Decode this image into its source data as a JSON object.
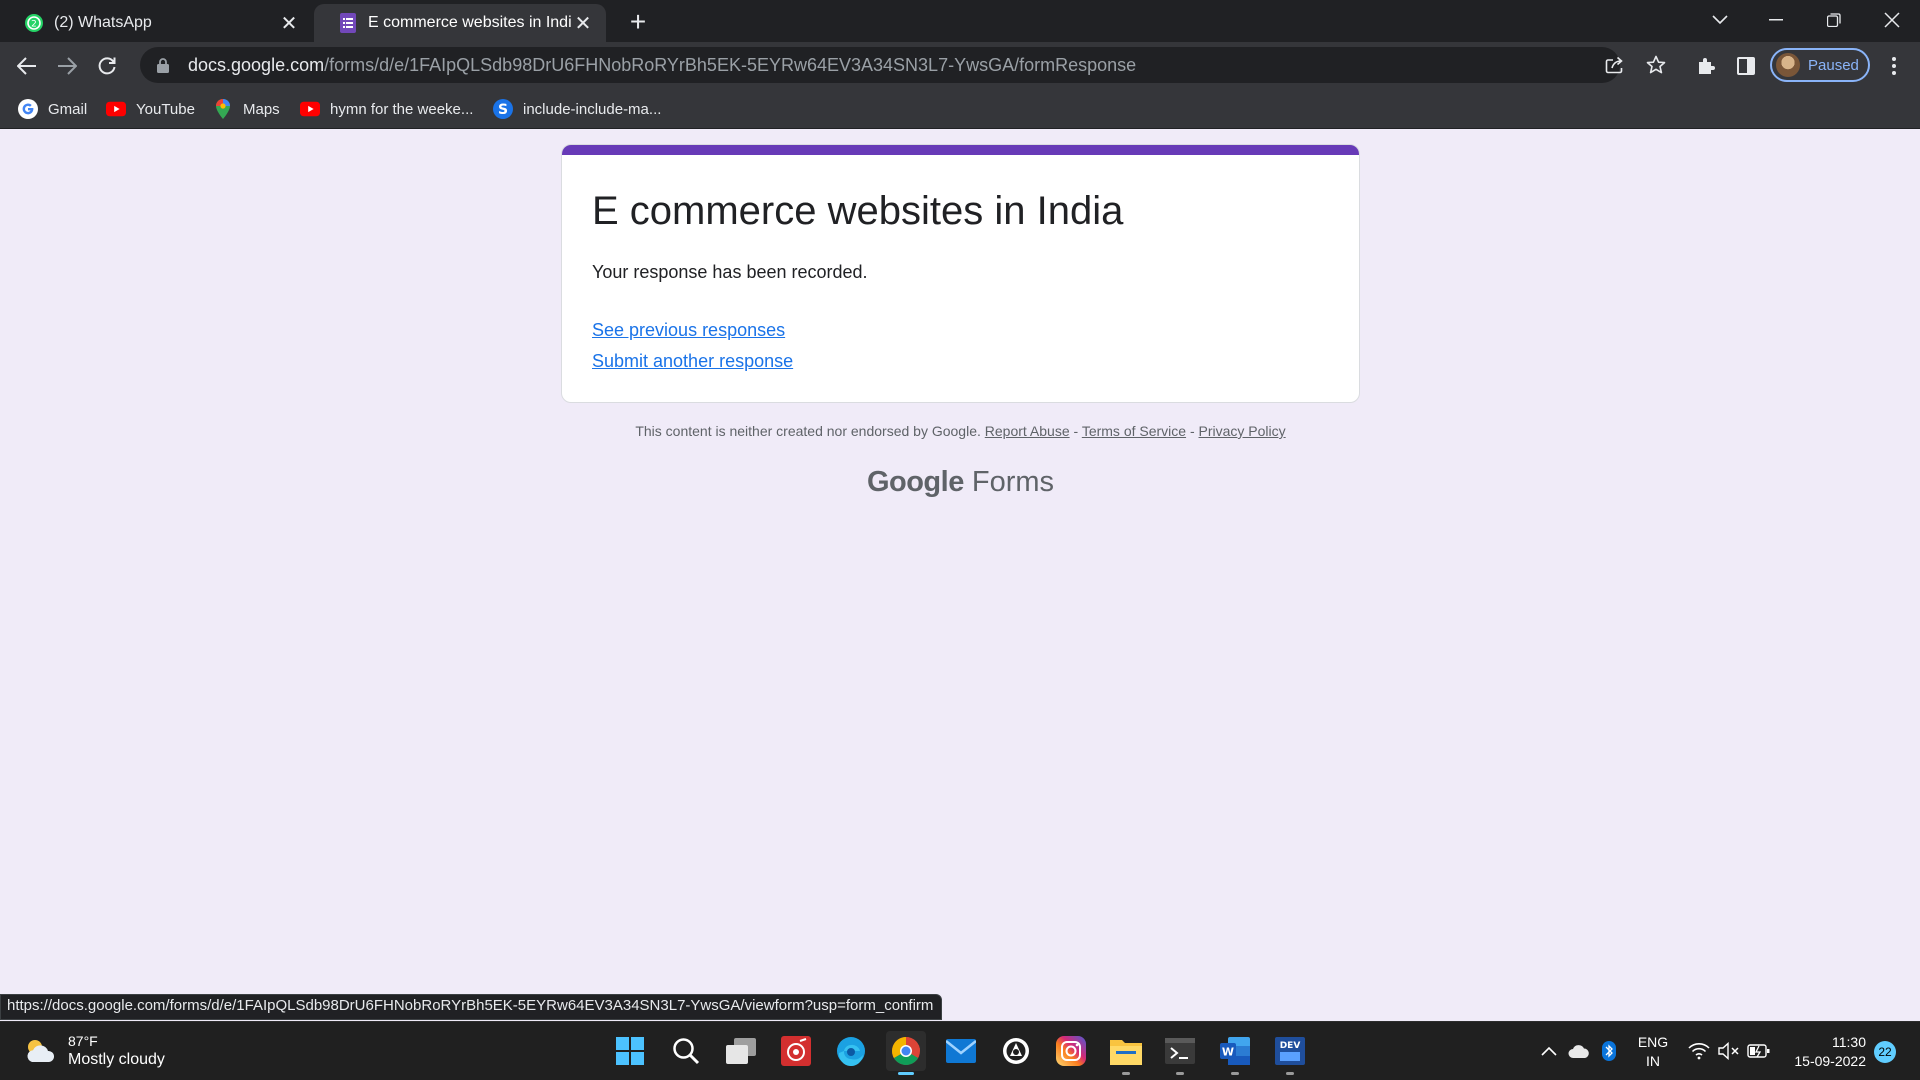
{
  "browser": {
    "tabs": [
      {
        "title": "(2) WhatsApp",
        "icon": "whatsapp-icon",
        "active": false
      },
      {
        "title": "E commerce websites in India",
        "icon": "google-forms-icon",
        "active": true
      }
    ],
    "url_host": "docs.google.com",
    "url_path": "/forms/d/e/1FAIpQLSdb98DrU6FHNobRoRYrBh5EK-5EYRw64EV3A34SN3L7-YwsGA/formResponse",
    "profile_label": "Paused",
    "bookmarks": [
      {
        "label": "Gmail",
        "icon": "google-icon"
      },
      {
        "label": "YouTube",
        "icon": "youtube-icon"
      },
      {
        "label": "Maps",
        "icon": "maps-icon"
      },
      {
        "label": "hymn for the weeke...",
        "icon": "youtube-icon"
      },
      {
        "label": "include-include-ma...",
        "icon": "s-icon"
      }
    ],
    "status_url": "https://docs.google.com/forms/d/e/1FAIpQLSdb98DrU6FHNobRoRYrBh5EK-5EYRw64EV3A34SN3L7-YwsGA/viewform?usp=form_confirm"
  },
  "form": {
    "title": "E commerce websites in India",
    "message": "Your response has been recorded.",
    "link_previous": "See previous responses",
    "link_another": "Submit another response",
    "accent_color": "#673ab7"
  },
  "footer": {
    "disclaimer": "This content is neither created nor endorsed by Google.",
    "report_abuse": "Report Abuse",
    "separator": " - ",
    "terms": "Terms of Service",
    "privacy": "Privacy Policy",
    "brand_google": "Google",
    "brand_forms": "Forms"
  },
  "taskbar": {
    "weather_temp": "87°F",
    "weather_condition": "Mostly cloudy",
    "language_line1": "ENG",
    "language_line2": "IN",
    "time": "11:30",
    "date": "15-09-2022",
    "notification_count": "22",
    "apps": [
      "windows-start-icon",
      "search-icon",
      "task-view-icon",
      "app-red-icon",
      "edge-icon",
      "chrome-icon",
      "mail-icon",
      "app-circle-icon",
      "instagram-icon",
      "file-explorer-icon",
      "terminal-icon",
      "word-icon",
      "dev-icon"
    ]
  }
}
